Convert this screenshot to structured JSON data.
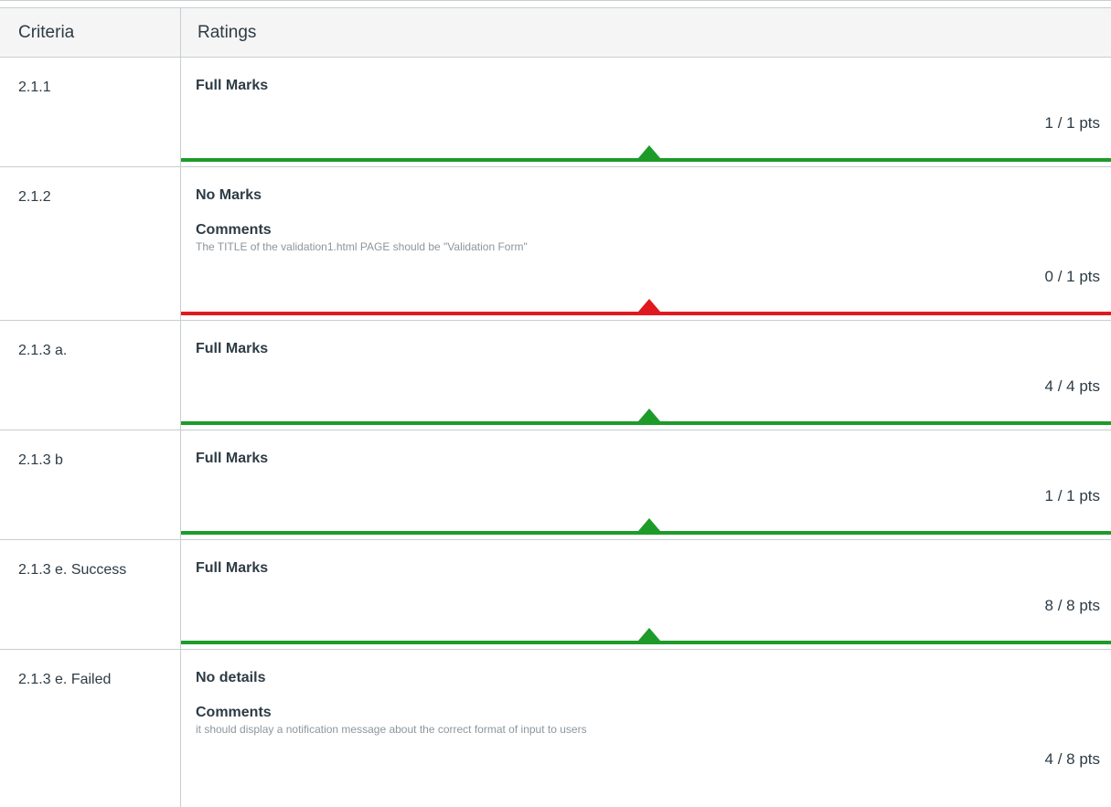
{
  "header": {
    "criteria": "Criteria",
    "ratings": "Ratings"
  },
  "colors": {
    "full": "#1d9b29",
    "none": "#e0191e"
  },
  "rows": [
    {
      "criterion": "2.1.1",
      "rating": "Full Marks",
      "comments_label": "",
      "comment": "",
      "points": "1 / 1 pts",
      "status": "full"
    },
    {
      "criterion": "2.1.2",
      "rating": "No Marks",
      "comments_label": "Comments",
      "comment": "The TITLE of the validation1.html PAGE should be \"Validation Form\"",
      "points": "0 / 1 pts",
      "status": "none"
    },
    {
      "criterion": "2.1.3 a.",
      "rating": "Full Marks",
      "comments_label": "",
      "comment": "",
      "points": "4 / 4 pts",
      "status": "full"
    },
    {
      "criterion": "2.1.3 b",
      "rating": "Full Marks",
      "comments_label": "",
      "comment": "",
      "points": "1 / 1 pts",
      "status": "full"
    },
    {
      "criterion": "2.1.3 e. Success",
      "rating": "Full Marks",
      "comments_label": "",
      "comment": "",
      "points": "8 / 8 pts",
      "status": "full"
    },
    {
      "criterion": "2.1.3 e. Failed",
      "rating": "No details",
      "comments_label": "Comments",
      "comment": "it should display a notification message about the correct format of input to users",
      "points": "4 / 8 pts",
      "status": ""
    }
  ]
}
